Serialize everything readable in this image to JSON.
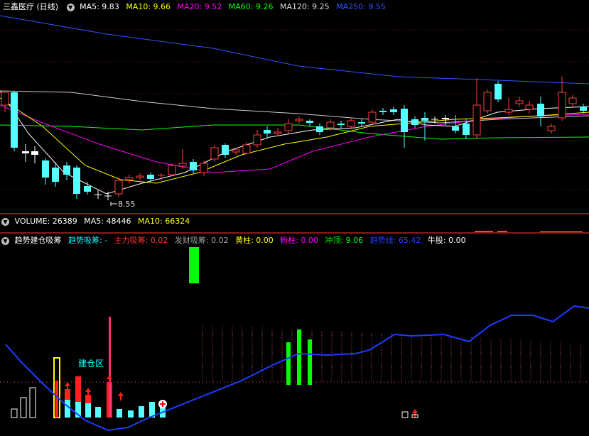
{
  "main": {
    "title": "三鑫医疗 (日线)",
    "ma": [
      {
        "label": "MA5: 9.83",
        "color": "#ffffff"
      },
      {
        "label": "MA10: 9.66",
        "color": "#ffff00"
      },
      {
        "label": "MA20: 9.52",
        "color": "#ff00ff"
      },
      {
        "label": "MA60: 9.26",
        "color": "#00ff00"
      },
      {
        "label": "MA120: 9.25",
        "color": "#dddddd"
      },
      {
        "label": "MA250: 9.55",
        "color": "#3355ff"
      }
    ],
    "low_label": "8.55"
  },
  "volume": {
    "items": [
      {
        "label": "VOLUME: 26389",
        "color": "#ffffff"
      },
      {
        "label": "MA5: 48446",
        "color": "#ffffff"
      },
      {
        "label": "MA10: 66324",
        "color": "#ffff00"
      }
    ]
  },
  "indicator": {
    "items": [
      {
        "label": "趋势建仓吸筹",
        "color": "#ffffff"
      },
      {
        "label": "趋势吸筹: -",
        "color": "#00ffff"
      },
      {
        "label": "主力吸筹: 0.02",
        "color": "#ff3030"
      },
      {
        "label": "发财吸筹: 0.02",
        "color": "#a0a0a0"
      },
      {
        "label": "黄柱: 0.00",
        "color": "#ffff00"
      },
      {
        "label": "粉柱: 0.00",
        "color": "#ff00ff"
      },
      {
        "label": "冲顶: 9.06",
        "color": "#00ff00"
      },
      {
        "label": "趋势线: 65.42",
        "color": "#2040ff"
      },
      {
        "label": "牛股: 0.00",
        "color": "#ffffff"
      }
    ],
    "zone_label": "建仓区"
  }
}
